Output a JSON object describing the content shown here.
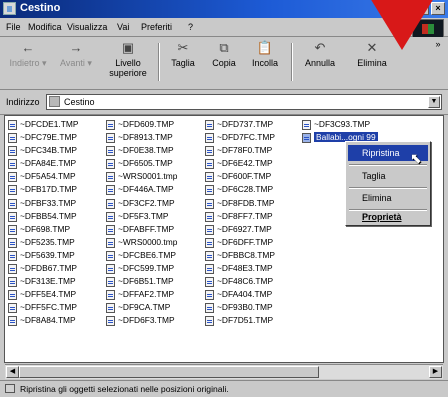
{
  "window": {
    "title": "Cestino"
  },
  "menu": [
    "File",
    "Modifica",
    "Visualizza",
    "Vai",
    "Preferiti",
    "?"
  ],
  "toolbar": {
    "back": "Indietro",
    "forward": "Avanti",
    "up_line1": "Livello",
    "up_line2": "superiore",
    "cut": "Taglia",
    "copy": "Copia",
    "paste": "Incolla",
    "undo": "Annulla",
    "delete": "Elimina"
  },
  "address": {
    "label": "Indirizzo",
    "value": "Cestino"
  },
  "files": {
    "col1": [
      "~DFCDE1.TMP",
      "~DFC79E.TMP",
      "~DFC34B.TMP",
      "~DFA84E.TMP",
      "~DF5A54.TMP",
      "~DFB17D.TMP",
      "~DFBF33.TMP",
      "~DFBB54.TMP",
      "~DF698.TMP",
      "~DF5235.TMP",
      "~DF5639.TMP",
      "~DFDB67.TMP",
      "~DF313E.TMP",
      "~DFF5E4.TMP",
      "~DFF5FC.TMP",
      "~DF8A84.TMP"
    ],
    "col2": [
      "~DFD609.TMP",
      "~DF8913.TMP",
      "~DF0E38.TMP",
      "~DF6505.TMP",
      "~WRS0001.tmp",
      "~DF446A.TMP",
      "~DF3CF2.TMP",
      "~DF5F3.TMP",
      "~DFABFF.TMP",
      "~WRS0000.tmp",
      "~DFCBE6.TMP",
      "~DFC599.TMP",
      "~DF6B51.TMP",
      "~DFFAF2.TMP",
      "~DF9CA.TMP",
      "~DFD6F3.TMP"
    ],
    "col3": [
      "~DFD737.TMP",
      "~DFD7FC.TMP",
      "~DF78F0.TMP",
      "~DF6E42.TMP",
      "~DF600F.TMP",
      "~DF6C28.TMP",
      "~DF8FDB.TMP",
      "~DF8FF7.TMP",
      "~DF6927.TMP",
      "~DF6DFF.TMP",
      "~DFBBC8.TMP",
      "~DF48E3.TMP",
      "~DF48C6.TMP",
      "~DFA404.TMP",
      "~DF93B0.TMP",
      "~DF7D51.TMP"
    ],
    "col4": [
      "~DF3C93.TMP"
    ],
    "selected": "Ballabi...ogni 99"
  },
  "context_menu": {
    "restore": "Ripristina",
    "cut": "Taglia",
    "delete": "Elimina",
    "properties": "Proprietà"
  },
  "status": {
    "text": "Ripristina gli oggetti selezionati nelle posizioni originali."
  }
}
